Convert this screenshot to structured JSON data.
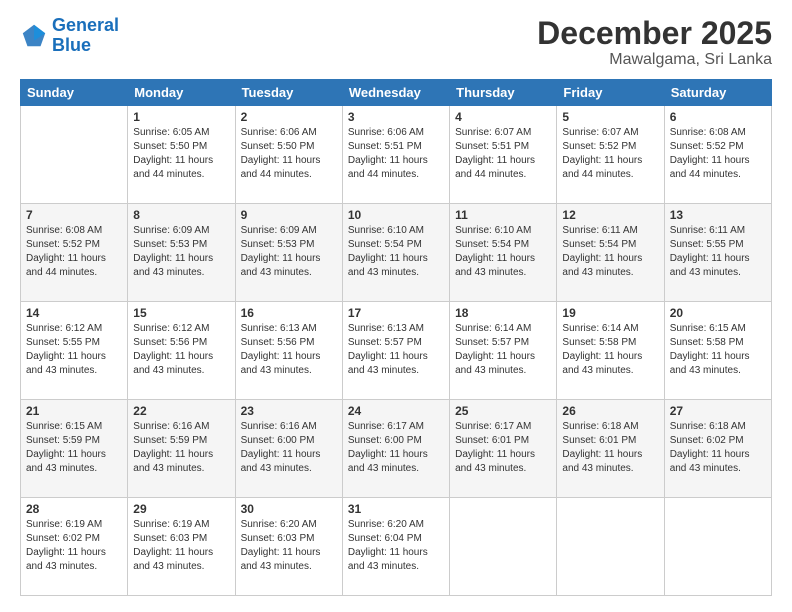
{
  "logo": {
    "line1": "General",
    "line2": "Blue"
  },
  "title": "December 2025",
  "location": "Mawalgama, Sri Lanka",
  "days_header": [
    "Sunday",
    "Monday",
    "Tuesday",
    "Wednesday",
    "Thursday",
    "Friday",
    "Saturday"
  ],
  "weeks": [
    [
      {
        "day": "",
        "sunrise": "",
        "sunset": "",
        "daylight": ""
      },
      {
        "day": "1",
        "sunrise": "Sunrise: 6:05 AM",
        "sunset": "Sunset: 5:50 PM",
        "daylight": "Daylight: 11 hours and 44 minutes."
      },
      {
        "day": "2",
        "sunrise": "Sunrise: 6:06 AM",
        "sunset": "Sunset: 5:50 PM",
        "daylight": "Daylight: 11 hours and 44 minutes."
      },
      {
        "day": "3",
        "sunrise": "Sunrise: 6:06 AM",
        "sunset": "Sunset: 5:51 PM",
        "daylight": "Daylight: 11 hours and 44 minutes."
      },
      {
        "day": "4",
        "sunrise": "Sunrise: 6:07 AM",
        "sunset": "Sunset: 5:51 PM",
        "daylight": "Daylight: 11 hours and 44 minutes."
      },
      {
        "day": "5",
        "sunrise": "Sunrise: 6:07 AM",
        "sunset": "Sunset: 5:52 PM",
        "daylight": "Daylight: 11 hours and 44 minutes."
      },
      {
        "day": "6",
        "sunrise": "Sunrise: 6:08 AM",
        "sunset": "Sunset: 5:52 PM",
        "daylight": "Daylight: 11 hours and 44 minutes."
      }
    ],
    [
      {
        "day": "7",
        "sunrise": "Sunrise: 6:08 AM",
        "sunset": "Sunset: 5:52 PM",
        "daylight": "Daylight: 11 hours and 44 minutes."
      },
      {
        "day": "8",
        "sunrise": "Sunrise: 6:09 AM",
        "sunset": "Sunset: 5:53 PM",
        "daylight": "Daylight: 11 hours and 43 minutes."
      },
      {
        "day": "9",
        "sunrise": "Sunrise: 6:09 AM",
        "sunset": "Sunset: 5:53 PM",
        "daylight": "Daylight: 11 hours and 43 minutes."
      },
      {
        "day": "10",
        "sunrise": "Sunrise: 6:10 AM",
        "sunset": "Sunset: 5:54 PM",
        "daylight": "Daylight: 11 hours and 43 minutes."
      },
      {
        "day": "11",
        "sunrise": "Sunrise: 6:10 AM",
        "sunset": "Sunset: 5:54 PM",
        "daylight": "Daylight: 11 hours and 43 minutes."
      },
      {
        "day": "12",
        "sunrise": "Sunrise: 6:11 AM",
        "sunset": "Sunset: 5:54 PM",
        "daylight": "Daylight: 11 hours and 43 minutes."
      },
      {
        "day": "13",
        "sunrise": "Sunrise: 6:11 AM",
        "sunset": "Sunset: 5:55 PM",
        "daylight": "Daylight: 11 hours and 43 minutes."
      }
    ],
    [
      {
        "day": "14",
        "sunrise": "Sunrise: 6:12 AM",
        "sunset": "Sunset: 5:55 PM",
        "daylight": "Daylight: 11 hours and 43 minutes."
      },
      {
        "day": "15",
        "sunrise": "Sunrise: 6:12 AM",
        "sunset": "Sunset: 5:56 PM",
        "daylight": "Daylight: 11 hours and 43 minutes."
      },
      {
        "day": "16",
        "sunrise": "Sunrise: 6:13 AM",
        "sunset": "Sunset: 5:56 PM",
        "daylight": "Daylight: 11 hours and 43 minutes."
      },
      {
        "day": "17",
        "sunrise": "Sunrise: 6:13 AM",
        "sunset": "Sunset: 5:57 PM",
        "daylight": "Daylight: 11 hours and 43 minutes."
      },
      {
        "day": "18",
        "sunrise": "Sunrise: 6:14 AM",
        "sunset": "Sunset: 5:57 PM",
        "daylight": "Daylight: 11 hours and 43 minutes."
      },
      {
        "day": "19",
        "sunrise": "Sunrise: 6:14 AM",
        "sunset": "Sunset: 5:58 PM",
        "daylight": "Daylight: 11 hours and 43 minutes."
      },
      {
        "day": "20",
        "sunrise": "Sunrise: 6:15 AM",
        "sunset": "Sunset: 5:58 PM",
        "daylight": "Daylight: 11 hours and 43 minutes."
      }
    ],
    [
      {
        "day": "21",
        "sunrise": "Sunrise: 6:15 AM",
        "sunset": "Sunset: 5:59 PM",
        "daylight": "Daylight: 11 hours and 43 minutes."
      },
      {
        "day": "22",
        "sunrise": "Sunrise: 6:16 AM",
        "sunset": "Sunset: 5:59 PM",
        "daylight": "Daylight: 11 hours and 43 minutes."
      },
      {
        "day": "23",
        "sunrise": "Sunrise: 6:16 AM",
        "sunset": "Sunset: 6:00 PM",
        "daylight": "Daylight: 11 hours and 43 minutes."
      },
      {
        "day": "24",
        "sunrise": "Sunrise: 6:17 AM",
        "sunset": "Sunset: 6:00 PM",
        "daylight": "Daylight: 11 hours and 43 minutes."
      },
      {
        "day": "25",
        "sunrise": "Sunrise: 6:17 AM",
        "sunset": "Sunset: 6:01 PM",
        "daylight": "Daylight: 11 hours and 43 minutes."
      },
      {
        "day": "26",
        "sunrise": "Sunrise: 6:18 AM",
        "sunset": "Sunset: 6:01 PM",
        "daylight": "Daylight: 11 hours and 43 minutes."
      },
      {
        "day": "27",
        "sunrise": "Sunrise: 6:18 AM",
        "sunset": "Sunset: 6:02 PM",
        "daylight": "Daylight: 11 hours and 43 minutes."
      }
    ],
    [
      {
        "day": "28",
        "sunrise": "Sunrise: 6:19 AM",
        "sunset": "Sunset: 6:02 PM",
        "daylight": "Daylight: 11 hours and 43 minutes."
      },
      {
        "day": "29",
        "sunrise": "Sunrise: 6:19 AM",
        "sunset": "Sunset: 6:03 PM",
        "daylight": "Daylight: 11 hours and 43 minutes."
      },
      {
        "day": "30",
        "sunrise": "Sunrise: 6:20 AM",
        "sunset": "Sunset: 6:03 PM",
        "daylight": "Daylight: 11 hours and 43 minutes."
      },
      {
        "day": "31",
        "sunrise": "Sunrise: 6:20 AM",
        "sunset": "Sunset: 6:04 PM",
        "daylight": "Daylight: 11 hours and 43 minutes."
      },
      {
        "day": "",
        "sunrise": "",
        "sunset": "",
        "daylight": ""
      },
      {
        "day": "",
        "sunrise": "",
        "sunset": "",
        "daylight": ""
      },
      {
        "day": "",
        "sunrise": "",
        "sunset": "",
        "daylight": ""
      }
    ]
  ]
}
